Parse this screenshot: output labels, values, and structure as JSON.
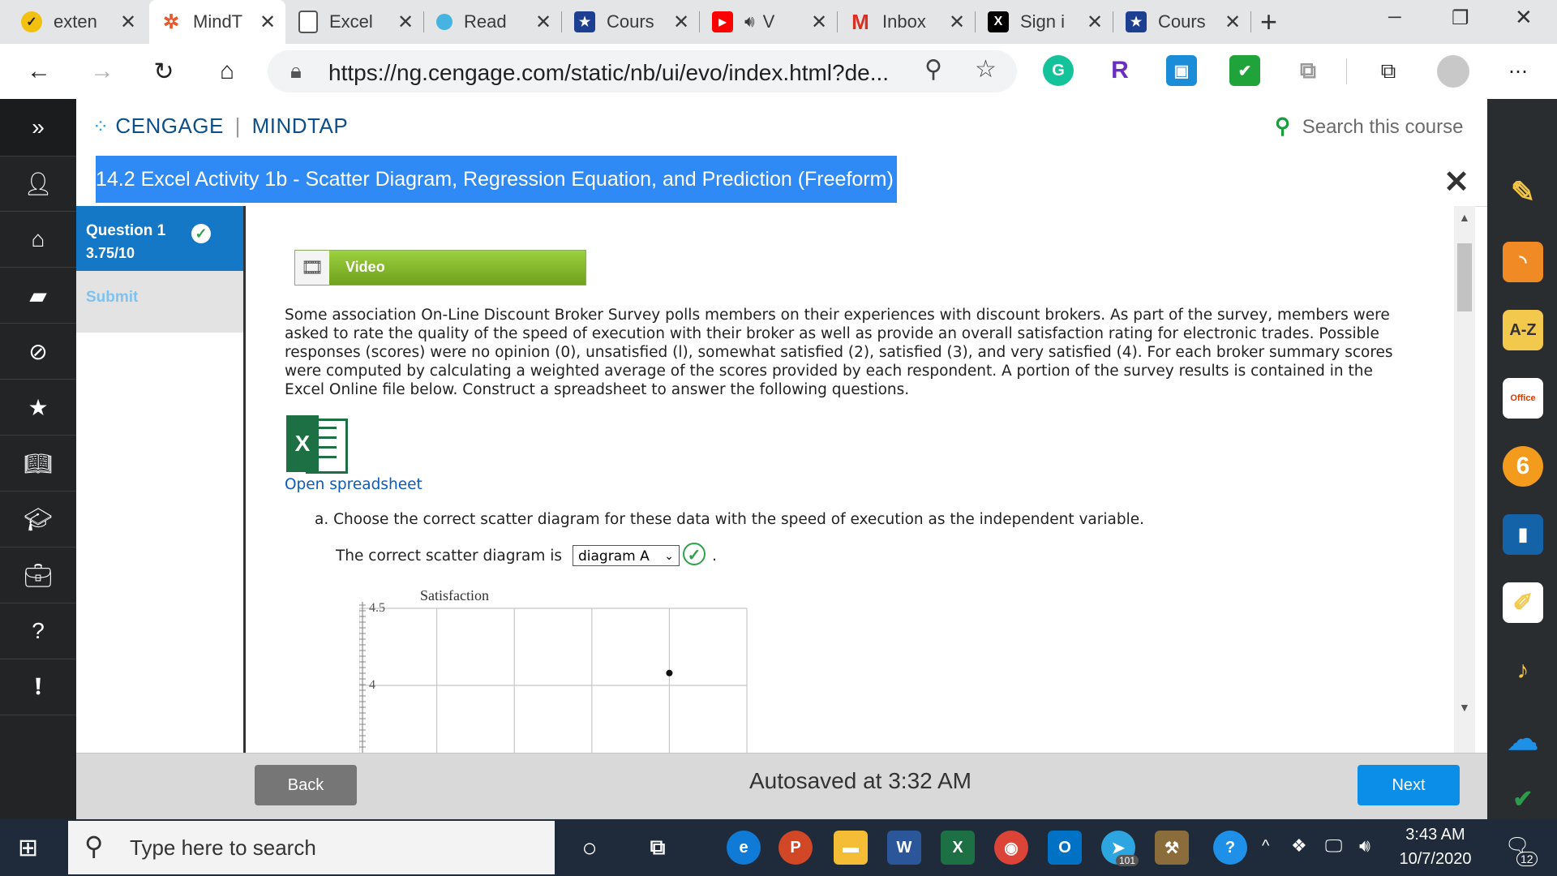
{
  "browser": {
    "tabs": [
      {
        "label": "exten",
        "icon": "extension-check-icon",
        "color": "#f2c10f"
      },
      {
        "label": "MindT",
        "icon": "mindtap-icon",
        "color": "#e8582a",
        "active": true
      },
      {
        "label": "Excel",
        "icon": "document-icon",
        "color": "#ffffff"
      },
      {
        "label": "Read",
        "icon": "reader-icon",
        "color": "#47b3e0"
      },
      {
        "label": "Cours",
        "icon": "course-star-icon",
        "color": "#1d3f91"
      },
      {
        "label": "V",
        "icon": "youtube-icon",
        "color": "#ff0000"
      },
      {
        "label": "Inbox",
        "icon": "gmail-icon",
        "color": "#d93025"
      },
      {
        "label": "Sign i",
        "icon": "x-logo-icon",
        "color": "#000000"
      },
      {
        "label": "Cours",
        "icon": "course-star-icon",
        "color": "#1d3f91"
      }
    ],
    "url": "https://ng.cengage.com/static/nb/ui/evo/index.html?de...",
    "new_tab": "+",
    "window_controls": {
      "minimize": "─",
      "restore": "❐",
      "close": "✕"
    },
    "extensions": [
      {
        "name": "grammarly-icon",
        "label": "G",
        "color": "#15c39a"
      },
      {
        "name": "r-extension-icon",
        "label": "R",
        "color": "#6a2fc2"
      },
      {
        "name": "calendar-extension-icon",
        "label": "▣",
        "color": "#1a8cd8"
      },
      {
        "name": "checkmark-extension-icon",
        "label": "✔",
        "color": "#1fa33a"
      },
      {
        "name": "copy-extension-icon",
        "label": "⧉",
        "color": "#9a9a9a"
      }
    ]
  },
  "app": {
    "brand": "CENGAGE",
    "product": "MINDTAP",
    "search_placeholder": "Search this course",
    "help": "?"
  },
  "activity": {
    "title": "14.2 Excel Activity 1b - Scatter Diagram, Regression Equation, and Prediction (Freeform)",
    "close": "✕"
  },
  "question_panel": {
    "label": "Question 1",
    "score": "3.75/10",
    "submit": "Submit"
  },
  "content": {
    "video_label": "Video",
    "paragraph": "Some association On-Line Discount Broker Survey polls members on their experiences with discount brokers. As part of the survey, members were asked to rate the quality of the speed of execution with their broker as well as provide an overall satisfaction rating for electronic trades. Possible responses (scores) were no opinion (0), unsatisfied (l), somewhat satisfied (2), satisfied (3), and very satisfied (4). For each broker summary scores were computed by calculating a weighted average of the scores provided by each respondent. A portion of the survey results is contained in the Excel Online file below. Construct a spreadsheet to answer the following questions.",
    "excel_link": "Open spreadsheet",
    "question_a_letter": "a.",
    "question_a": "Choose the correct scatter diagram for these data with the speed of execution as the independent variable.",
    "answer_prefix": "The correct scatter diagram is",
    "answer_selected": "diagram A",
    "answer_suffix": "."
  },
  "chart_data": {
    "type": "scatter",
    "title": "",
    "ylabel": "Satisfaction",
    "xlabel": "",
    "ylim": [
      4,
      4.5
    ],
    "y_ticks": [
      "4.5",
      "4"
    ],
    "grid": true,
    "points": [
      {
        "x_column": 4,
        "y": 4.08
      }
    ]
  },
  "footer": {
    "back": "Back",
    "autosave": "Autosaved at 3:32 AM",
    "next": "Next"
  },
  "taskbar": {
    "search_placeholder": "Type here to search",
    "time": "3:43 AM",
    "date": "10/7/2020",
    "notification_count": "12",
    "telegram_badge": "101"
  },
  "colors": {
    "title_highlight": "#2f8af5",
    "question_card": "#1478c7",
    "next_button": "#0a8ee8",
    "video_button": "#85b92c",
    "link": "#0a5cc2"
  }
}
